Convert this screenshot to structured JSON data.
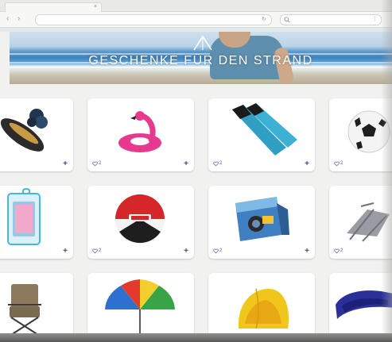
{
  "browser": {
    "tab_close": "×",
    "back_label": "‹",
    "forward_label": "›",
    "address": "",
    "search_placeholder": "",
    "reload_label": "↻",
    "menu_label": "⋮"
  },
  "hero": {
    "title": "GESCHENKE FÜR DEN STRAND",
    "subtitle": ""
  },
  "product_grid": {
    "add_label": "+",
    "rows": [
      [
        {
          "name": "sandals-and-bag",
          "like_count": "",
          "show_add": true
        },
        {
          "name": "flamingo-float",
          "like_count": "2",
          "show_add": true
        },
        {
          "name": "diving-fins",
          "like_count": "2",
          "show_add": true
        },
        {
          "name": "soccer-ball",
          "like_count": "2",
          "show_add": false
        }
      ],
      [
        {
          "name": "waterproof-phone-case",
          "like_count": "",
          "show_add": true
        },
        {
          "name": "beach-ball",
          "like_count": "2",
          "show_add": true
        },
        {
          "name": "disposable-camera",
          "like_count": "2",
          "show_add": true
        },
        {
          "name": "beach-lounger",
          "like_count": "2",
          "show_add": false
        }
      ],
      [
        {
          "name": "folding-chair",
          "like_count": "",
          "show_add": false
        },
        {
          "name": "beach-umbrella",
          "like_count": "",
          "show_add": false
        },
        {
          "name": "beach-tent",
          "like_count": "",
          "show_add": false
        },
        {
          "name": "inflatable-lounger",
          "like_count": "",
          "show_add": false
        }
      ]
    ]
  },
  "colors": {
    "accent": "#3b4a9a",
    "like": "#5563a8",
    "card_background": "#ffffff",
    "page_background": "#f1f1ef"
  }
}
